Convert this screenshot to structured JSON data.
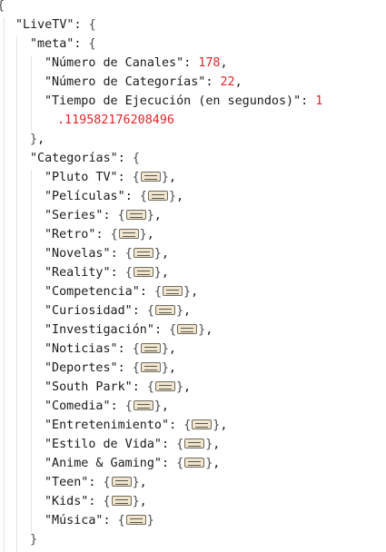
{
  "json": {
    "open_brace": "{",
    "root_key": "\"LiveTV\"",
    "meta": {
      "key": "\"meta\"",
      "fields": [
        {
          "key": "\"Número de Canales\"",
          "value": "178"
        },
        {
          "key": "\"Número de Categorías\"",
          "value": "22"
        },
        {
          "key": "\"Tiempo de Ejecución (en segundos)\"",
          "value_part1": "1",
          "value_part2": ".119582176208496"
        }
      ]
    },
    "categorias": {
      "key": "\"Categorías\"",
      "items": [
        "\"Pluto TV\"",
        "\"Películas\"",
        "\"Series\"",
        "\"Retro\"",
        "\"Novelas\"",
        "\"Reality\"",
        "\"Competencia\"",
        "\"Curiosidad\"",
        "\"Investigación\"",
        "\"Noticias\"",
        "\"Deportes\"",
        "\"South Park\"",
        "\"Comedia\"",
        "\"Entretenimiento\"",
        "\"Estilo de Vida\"",
        "\"Anime & Gaming\"",
        "\"Teen\"",
        "\"Kids\"",
        "\"Música\""
      ]
    }
  }
}
